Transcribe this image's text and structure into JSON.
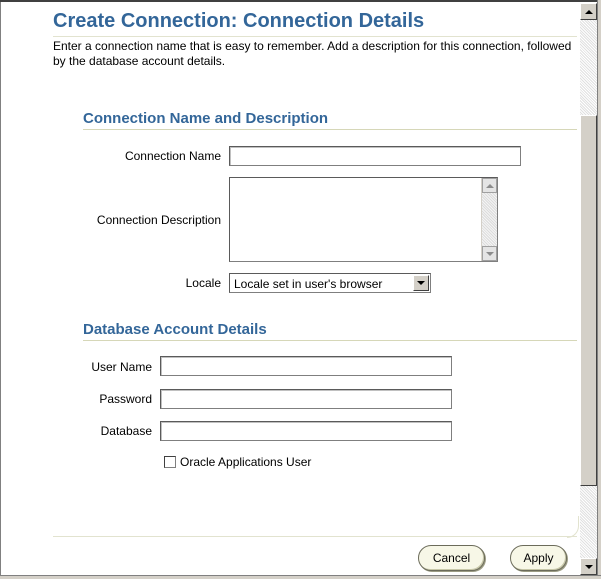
{
  "page": {
    "title": "Create Connection: Connection Details",
    "intro": "Enter a connection name that is easy to remember. Add a description for this connection, followed by the database account details."
  },
  "section_connection": {
    "heading": "Connection Name and Description",
    "name_label": "Connection Name",
    "name_value": "",
    "description_label": "Connection Description",
    "description_value": "",
    "locale_label": "Locale",
    "locale_value": "Locale set in user's browser"
  },
  "section_database": {
    "heading": "Database Account Details",
    "username_label": "User Name",
    "username_value": "",
    "password_label": "Password",
    "password_value": "",
    "database_label": "Database",
    "database_value": "",
    "oracle_apps_label": "Oracle Applications User",
    "oracle_apps_checked": false
  },
  "buttons": {
    "cancel": "Cancel",
    "apply": "Apply"
  },
  "icons": {
    "textarea_up": "scroll-up-icon",
    "textarea_down": "scroll-down-icon",
    "select_arrow": "chevron-down-icon",
    "window_up": "scroll-up-icon",
    "window_down": "scroll-down-icon"
  },
  "colors": {
    "heading": "#336699",
    "rule": "#d6d7b8",
    "button_fill": "#f7f7e7"
  }
}
